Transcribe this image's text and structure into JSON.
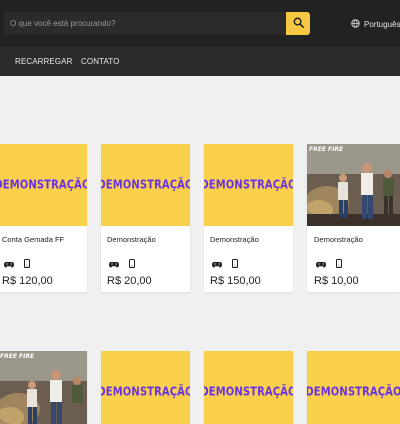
{
  "header": {
    "search_placeholder": "O que você está procurando?",
    "language_label": "Português"
  },
  "nav": {
    "items": [
      {
        "label": "RECARREGAR"
      },
      {
        "label": "CONTATO"
      }
    ]
  },
  "products_row1": [
    {
      "title": "Conta Gemada FF",
      "price": "R$ 120,00",
      "image": "DEMONSTRAÇÃO"
    },
    {
      "title": "Demonstração",
      "price": "R$ 20,00",
      "image": "DEMONSTRAÇÃO"
    },
    {
      "title": "Demonstração",
      "price": "R$ 150,00",
      "image": "DEMONSTRAÇÃO"
    },
    {
      "title": "Demonstração",
      "price": "R$ 10,00",
      "image_logo": "FREE FIRE"
    }
  ],
  "products_row2": [
    {
      "image_logo": "FREE FIRE"
    },
    {
      "image": "DEMONSTRAÇÃO"
    },
    {
      "image": "DEMONSTRAÇÃO"
    },
    {
      "image": "DEMONSTRAÇÃO"
    }
  ],
  "colors": {
    "topbar": "#222222",
    "navbar": "#2b2b2b",
    "accent": "#f6c844",
    "thumb_bg": "#f9d04c",
    "demo_text": "#6a32e6",
    "page_bg": "#f0f0f0"
  },
  "icons": {
    "search": "magnifier-icon",
    "language": "globe-icon",
    "platform_console": "gamepad-icon",
    "platform_mobile": "smartphone-icon"
  }
}
